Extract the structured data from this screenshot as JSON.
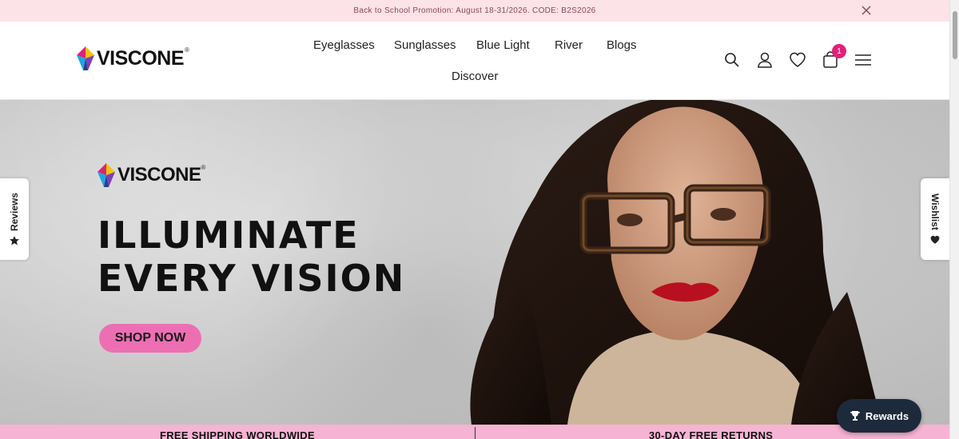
{
  "promo": {
    "text": "Back to School Promotion: August 18-31/2026. CODE: B2S2026"
  },
  "brand": {
    "name": "VISCONE",
    "reg": "®",
    "accent": "#e0207a"
  },
  "nav": {
    "items": [
      "Eyeglasses",
      "Sunglasses",
      "Blue Light",
      "River",
      "Blogs",
      "Discover"
    ]
  },
  "header_icons": [
    "search-icon",
    "user-icon",
    "heart-icon",
    "bag-icon",
    "menu-icon"
  ],
  "cart": {
    "count": "1"
  },
  "hero": {
    "headline_line1": "ILLUMINATE",
    "headline_line2": "EVERY VISION",
    "cta": "SHOP NOW",
    "cta_color": "#ec6fb4"
  },
  "side_tabs": {
    "reviews": "Reviews",
    "wishlist": "Wishlist"
  },
  "strip": {
    "left": "FREE SHIPPING WORLDWIDE",
    "right": "30-DAY FREE RETURNS",
    "color": "#f6b3d3"
  },
  "rewards": {
    "label": "Rewards"
  }
}
